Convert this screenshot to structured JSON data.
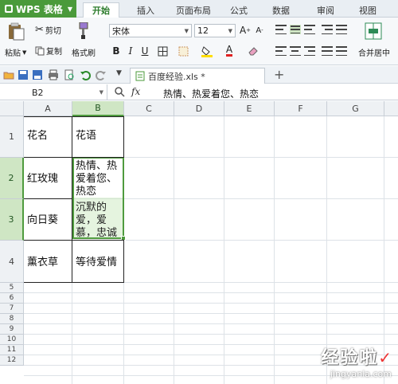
{
  "app": {
    "name": "WPS 表格"
  },
  "menu": {
    "tabs": [
      "开始",
      "插入",
      "页面布局",
      "公式",
      "数据",
      "审阅",
      "视图"
    ],
    "active": "开始"
  },
  "ribbon": {
    "paste": "粘贴",
    "cut": "剪切",
    "copy": "复制",
    "format_painter": "格式刷",
    "font_name": "宋体",
    "font_size": "12",
    "bold": "B",
    "italic": "I",
    "underline": "U",
    "merge_center": "合并居中"
  },
  "doc": {
    "tab_title": "百度经验.xls *"
  },
  "formula_bar": {
    "cell_ref": "B2",
    "fx": "fx",
    "content": "热情、热爱着您、热恋"
  },
  "sheet": {
    "columns": [
      "A",
      "B",
      "C",
      "D",
      "E",
      "F",
      "G"
    ],
    "rows": [
      "1",
      "2",
      "3",
      "4",
      "5",
      "6",
      "7",
      "8",
      "9",
      "10",
      "11",
      "12"
    ],
    "cells": {
      "A1": "花名",
      "B1": "花语",
      "A2": "红玫瑰",
      "B2": "热情、热爱着您、热恋",
      "A3": "向日葵",
      "B3": "沉默的爱，爱慕，忠诚",
      "A4": "薰衣草",
      "B4": "等待爱情"
    }
  },
  "watermark": {
    "cn": "经验啦",
    "en": "jingyanla.com"
  },
  "colors": {
    "accent": "#4a9a3a",
    "selection": "#4f9b3e"
  }
}
